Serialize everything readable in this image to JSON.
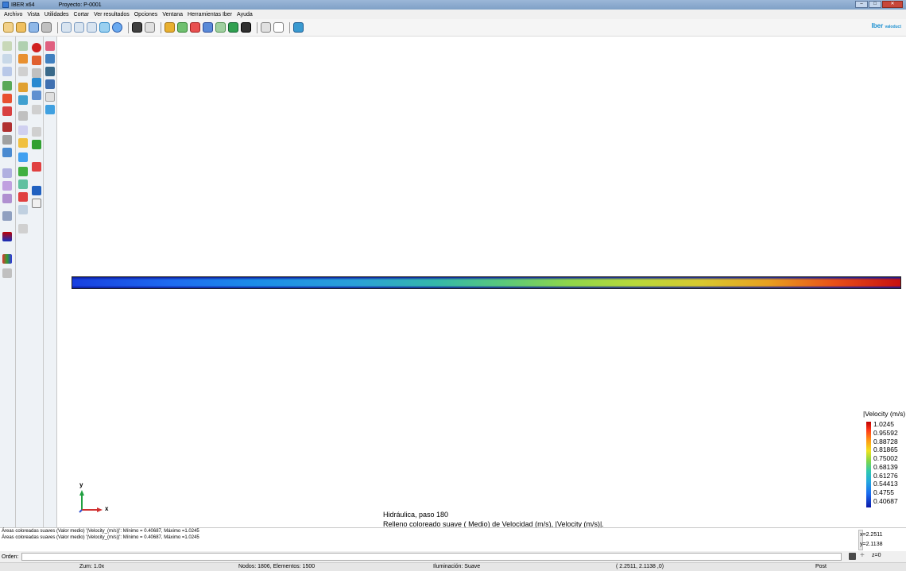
{
  "window": {
    "title": "IBER x64",
    "project": "Proyecto: P-0001"
  },
  "menu": [
    "Archivo",
    "Vista",
    "Utilidades",
    "Cortar",
    "Ver resultados",
    "Opciones",
    "Ventana",
    "Herramientas Iber",
    "Ayuda"
  ],
  "brand": {
    "name": "Iber",
    "sub": "valoduct"
  },
  "viewport": {
    "axis_x": "x",
    "axis_y": "y",
    "info_line1": "Hidráulica, paso 180",
    "info_line2": "Relleno coloreado suave ( Medio) de Velocidad (m/s), |Velocity (m/s)|."
  },
  "legend": {
    "title": "|Velocity (m/s)",
    "values": [
      "1.0245",
      "0.95592",
      "0.88728",
      "0.81865",
      "0.75002",
      "0.68139",
      "0.61276",
      "0.54413",
      "0.4755",
      "0.40687"
    ]
  },
  "messages": [
    "Áreas coloreadas suaves (Valor medio) '|Velocity_(m/s)|': Mínimo = 0.40687, Máximo =1.0245",
    "Áreas coloreadas suaves (Valor medio) '|Velocity_(m/s)|': Mínimo = 0.40687, Máximo =1.0245"
  ],
  "coords": {
    "x": "x=2.2511",
    "y": "y=2.1138",
    "z": "z=0"
  },
  "command": {
    "label": "Orden:",
    "value": ""
  },
  "status": {
    "zoom": "Zum: 1.0x",
    "nodes": "Nodos: 1806, Elementos: 1500",
    "lighting": "Iluminación: Suave",
    "coords": "( 2.2511, 2.1138 ,0)",
    "mode": "Post"
  }
}
